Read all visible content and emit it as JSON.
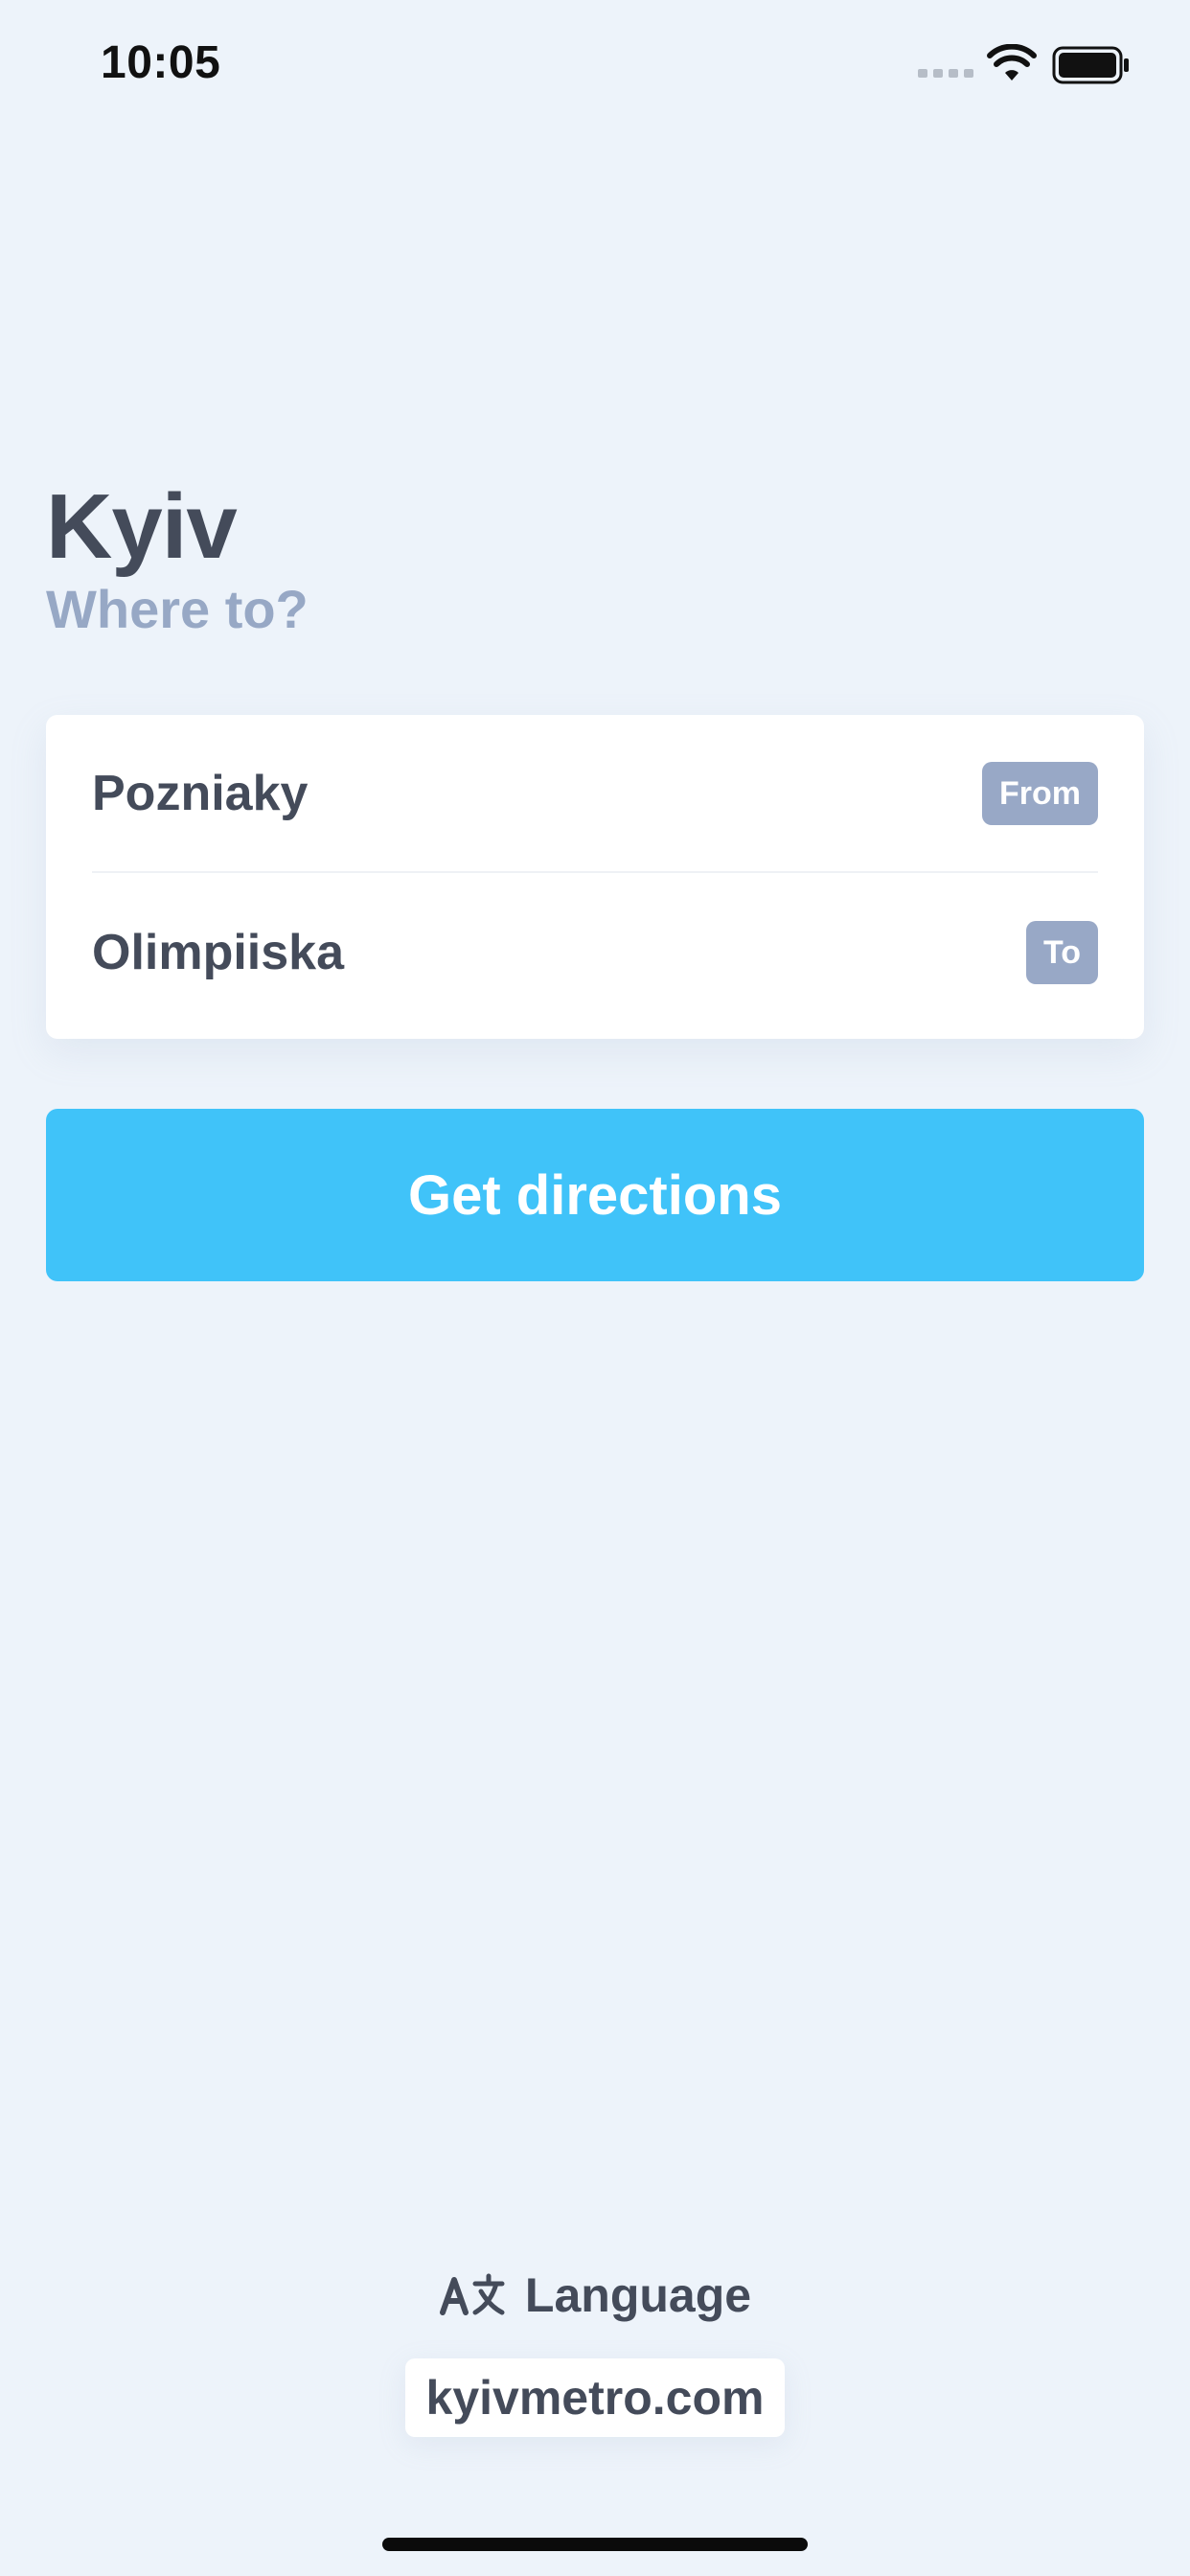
{
  "status_bar": {
    "time": "10:05",
    "icons": [
      "cellular-signal-icon",
      "wifi-icon",
      "battery-icon"
    ]
  },
  "header": {
    "city": "Kyiv",
    "subtitle": "Where to?"
  },
  "route": {
    "from": {
      "station": "Pozniaky",
      "badge": "From"
    },
    "to": {
      "station": "Olimpiiska",
      "badge": "To"
    }
  },
  "actions": {
    "get_directions": "Get directions"
  },
  "footer": {
    "language_icon": "translate-icon",
    "language_label": "Language",
    "website": "kyivmetro.com"
  },
  "colors": {
    "background": "#edf3fa",
    "primary_text": "#444b5a",
    "muted_text": "#97a8c5",
    "badge": "#98a8c6",
    "accent_button": "#40c3f9",
    "card": "#ffffff"
  }
}
